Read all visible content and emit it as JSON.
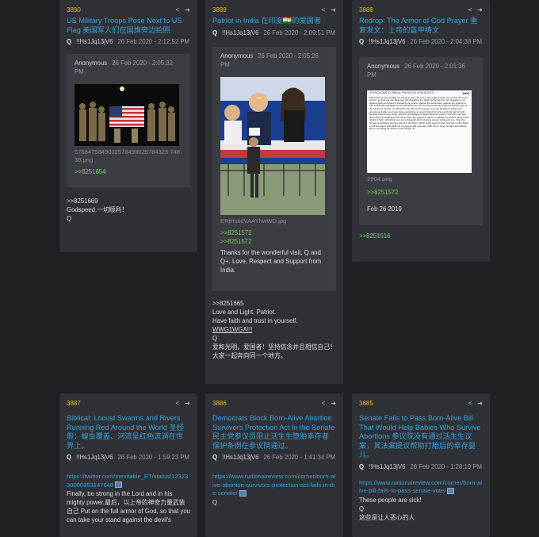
{
  "icons": {
    "share": "share-icon",
    "open": "arrow-right-circle-icon"
  },
  "cards": [
    {
      "num": "3890",
      "title": "US Military Troops Pose Next to US Flag 美国军人们在国旗旁边拍照",
      "author": "Q",
      "trip": "!!Hs1Jq13jV6",
      "time": "26 Feb 2020 - 2:12:52 PM",
      "reply_author": "Anonymous",
      "reply_time": "26 Feb 2020 - 2:05:32 PM",
      "image_name": "5768475849032578493025784325 74839.png",
      "ref": ">>8251654",
      "body": [
        ">>8251669",
        "Godspeed.一切顺利！",
        "Q"
      ]
    },
    {
      "num": "3889",
      "title": "Patriot in India 在印度🇮🇳的爱国者",
      "author": "Q",
      "trip": "!!Hs1Jq13jV6",
      "time": "26 Feb 2020 - 2:09:51 PM",
      "reply_author": "Anonymous",
      "reply_time": "26 Feb 2020 - 2:05:26 PM",
      "image_name": "ERjHskdVAAYhwWD.jpg",
      "refs": [
        ">>8251572",
        ">>8251572"
      ],
      "reply_body": "Thanks for the wonderful visit, Q and Q+. Love, Respect and Support from India.",
      "body": [
        ">>8251665",
        "Love and Light, Patriot.",
        "Have faith and trust in yourself."
      ],
      "wwg": "WWG1WGA!!!",
      "body2": [
        "Q",
        "爱和光明，爱国者！坚持信念并且相信自己！大家一起奔向同一个地方。"
      ]
    },
    {
      "num": "3888",
      "title": "Redrop: The Armor of God Prayer 重复发文：上帝的盔甲祷文",
      "author": "Q",
      "trip": "!!Hs1Jq13jV6",
      "time": "26 Feb 2020 - 2:04:38 PM",
      "reply_author": "Anonymous",
      "reply_time": "26 Feb 2020 - 2:01:36 PM",
      "image_name": "2904.png",
      "ref": ">>8251572",
      "reply_body": "Feb 26 2019",
      "after": ">>8251616",
      "doc": {
        "num": "2904",
        "head": "Q !!Hs1Jq13jV6 ID: 2fa8  No.  Feb 26 2019 16:56:48 (EST)",
        "text": "The Armor of God: Finally, be strong in the Lord and in his mighty power. Put on the full armor of God, so that you can take your stand against the devil's schemes. For our struggle is not against flesh and blood, but against the rulers, against the authorities, against the powers of this dark world and against the spiritual forces of evil in the heavenly realms. Therefore put on the full armor of God, so that when the day of evil comes, you may be able to stand your ground, and after you have done everything, to stand. Stand firm then, with the belt of truth buckled around your waist, with the breastplate of righteousness in place, and with your feet fitted with the readiness that comes from the gospel of peace. In addition to all this, take up the shield of faith, with which you can extinguish all the flaming arrows of the evil one. Take the helmet of salvation and the sword of the Spirit, which is the word of God. And pray in the Spirit on all occasions with all kinds of prayers and requests. With this in mind, be alert and always keep on praying for all the Lord's people. Q"
      }
    },
    {
      "num": "3887",
      "title": "Biblical: Locust Swarms and Rivers Running Red Around the World 圣经般：蝗虫覆盖、河流呈红色流淌在世界上。",
      "author": "Q",
      "trip": "!!Hs1Jq13jV6",
      "time": "26 Feb 2020 - 1:59:23 PM",
      "link": "https://twitter.com/Inevitable_ET/status/1232330000853147648",
      "body": "Finally, be strong in the Lord and in his mighty power.最后，以上帝的神奇力量武装自己 Put on the full armor of God, so that you can take your stand against the devil's"
    },
    {
      "num": "3886",
      "title": "Democrats Block Born-Alive Abortion Survivors Protection Act in the Senate 民主党参议员阻止活生生堕胎幸存者保护条例在参议院通过。",
      "author": "Q",
      "trip": "!!Hs1Jq13jV6",
      "time": "26 Feb 2020 - 1:41:34 PM",
      "link": "https://www.nationalreview.com/corner/born-alive-abortion-survivors-protection-act-fails-in-the-senate/",
      "body": "Q"
    },
    {
      "num": "3885",
      "title": "Senate Fails to Pass Born-Alive Bill That Would Help Babies Who Survive Abortions 参议院没有通过活生生议案，其法案提议帮助打胎后的幸存婴儿。",
      "author": "Q",
      "trip": "!!Hs1Jq13jV6",
      "time": "26 Feb 2020 - 1:28:19 PM",
      "link": "https://www.nationalreview.com/corner/born-alive-bill-fails-to-pass-senate-vote/",
      "body": [
        "These people are sick!",
        "Q",
        "这些是让人恶心的人"
      ]
    }
  ]
}
